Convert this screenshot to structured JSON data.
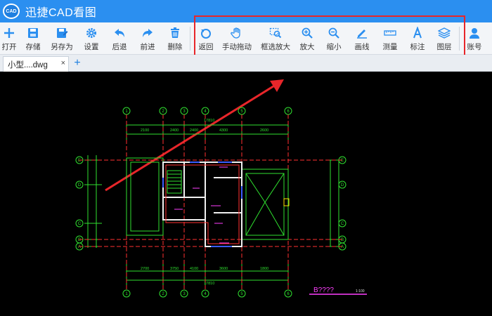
{
  "app": {
    "title": "迅捷CAD看图",
    "logo_text": "CAD"
  },
  "toolbar": {
    "open": "打开",
    "save": "存储",
    "save_as": "另存为",
    "settings": "设置",
    "back": "后退",
    "forward": "前进",
    "delete": "删除",
    "return": "返回",
    "pan": "手动拖动",
    "zoom_window": "框选放大",
    "zoom_in": "放大",
    "zoom_out": "缩小",
    "draw_line": "画线",
    "measure": "测量",
    "annotate": "标注",
    "layers": "图层",
    "account": "账号"
  },
  "tabs": {
    "doc": "小型....dwg",
    "close": "×",
    "add": "+"
  },
  "drawing": {
    "axes_top": [
      "1",
      "2",
      "3",
      "4",
      "5",
      "6"
    ],
    "axes_bottom": [
      "1",
      "2",
      "3",
      "4",
      "5",
      "6"
    ],
    "axes_side": [
      "E",
      "D",
      "C",
      "B",
      "A"
    ],
    "dims_top": [
      "2100",
      "2400",
      "2400",
      "4300",
      "2600"
    ],
    "dims_bottom": [
      "2700",
      "3750",
      "4100",
      "3600",
      "1800"
    ],
    "total_width": "17810",
    "caption": "B????",
    "scale": "1:100"
  },
  "colors": {
    "accent": "#2b8ff0",
    "highlight": "#e8262a",
    "cad_green": "#2fe02f",
    "cad_red": "#ff3030"
  }
}
